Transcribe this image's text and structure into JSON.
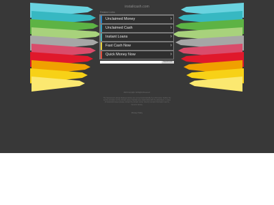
{
  "page": {
    "site_title": "instalicash.com",
    "related_label": "Related Links",
    "links": [
      {
        "label": "Unclaimed Money"
      },
      {
        "label": "Unclaimed Cash"
      },
      {
        "label": "Instant Loans"
      },
      {
        "label": "Fast Cash Now"
      },
      {
        "label": "Quick Money Now"
      }
    ],
    "search_placeholder": "",
    "search_button": "Search Ads",
    "copyright": "2024 Copyright. All Rights Reserved.",
    "disclaimer": "The Sponsored Listings displayed above are served automatically by a third party. Neither the service provider nor the domain owner maintain any relationship with the advertisers. In case of trademark issues please contact the domain owner directly (contact information can be found in whois).",
    "privacy": "Privacy Policy"
  },
  "colors": {
    "background": "#383838",
    "ribbon_left": [
      "#6ad3e0",
      "#37b8c2",
      "#5db344",
      "#a8d27c",
      "#a6a6a6",
      "#d94c6b",
      "#e0182b",
      "#f0a000",
      "#f7d117",
      "#fbe870"
    ],
    "ribbon_right": [
      "#6ad3e0",
      "#37b8c2",
      "#5db344",
      "#a8d27c",
      "#a6a6a6",
      "#d94c6b",
      "#e0182b",
      "#f0a000",
      "#f7d117",
      "#fbe870"
    ]
  }
}
